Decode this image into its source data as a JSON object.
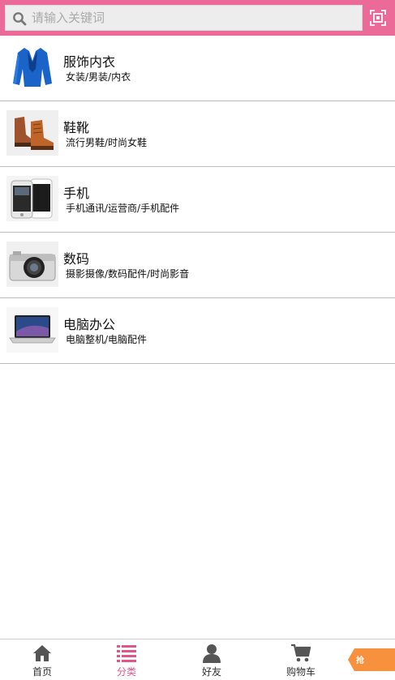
{
  "search": {
    "placeholder": "请输入关键词"
  },
  "categories": [
    {
      "title": "服饰内衣",
      "subtitle": "女装/男装/内衣",
      "icon": "clothing-image"
    },
    {
      "title": "鞋靴",
      "subtitle": "流行男鞋/时尚女鞋",
      "icon": "shoes-image"
    },
    {
      "title": "手机",
      "subtitle": "手机通讯/运营商/手机配件",
      "icon": "phone-image"
    },
    {
      "title": "数码",
      "subtitle": "摄影摄像/数码配件/时尚影音",
      "icon": "camera-image"
    },
    {
      "title": "电脑办公",
      "subtitle": "电脑整机/电脑配件",
      "icon": "laptop-image"
    }
  ],
  "bottom_nav": {
    "items": [
      {
        "label": "首页",
        "icon": "home-icon",
        "active": false
      },
      {
        "label": "分类",
        "icon": "list-icon",
        "active": true
      },
      {
        "label": "好友",
        "icon": "user-icon",
        "active": false
      },
      {
        "label": "购物车",
        "icon": "cart-icon",
        "active": false
      }
    ]
  },
  "promo_tab": {
    "label": "抢"
  },
  "colors": {
    "header": "#ec6a97",
    "active_tab": "#e2558a",
    "promo_tab": "#f7913d",
    "divider": "#bcbcbc"
  }
}
